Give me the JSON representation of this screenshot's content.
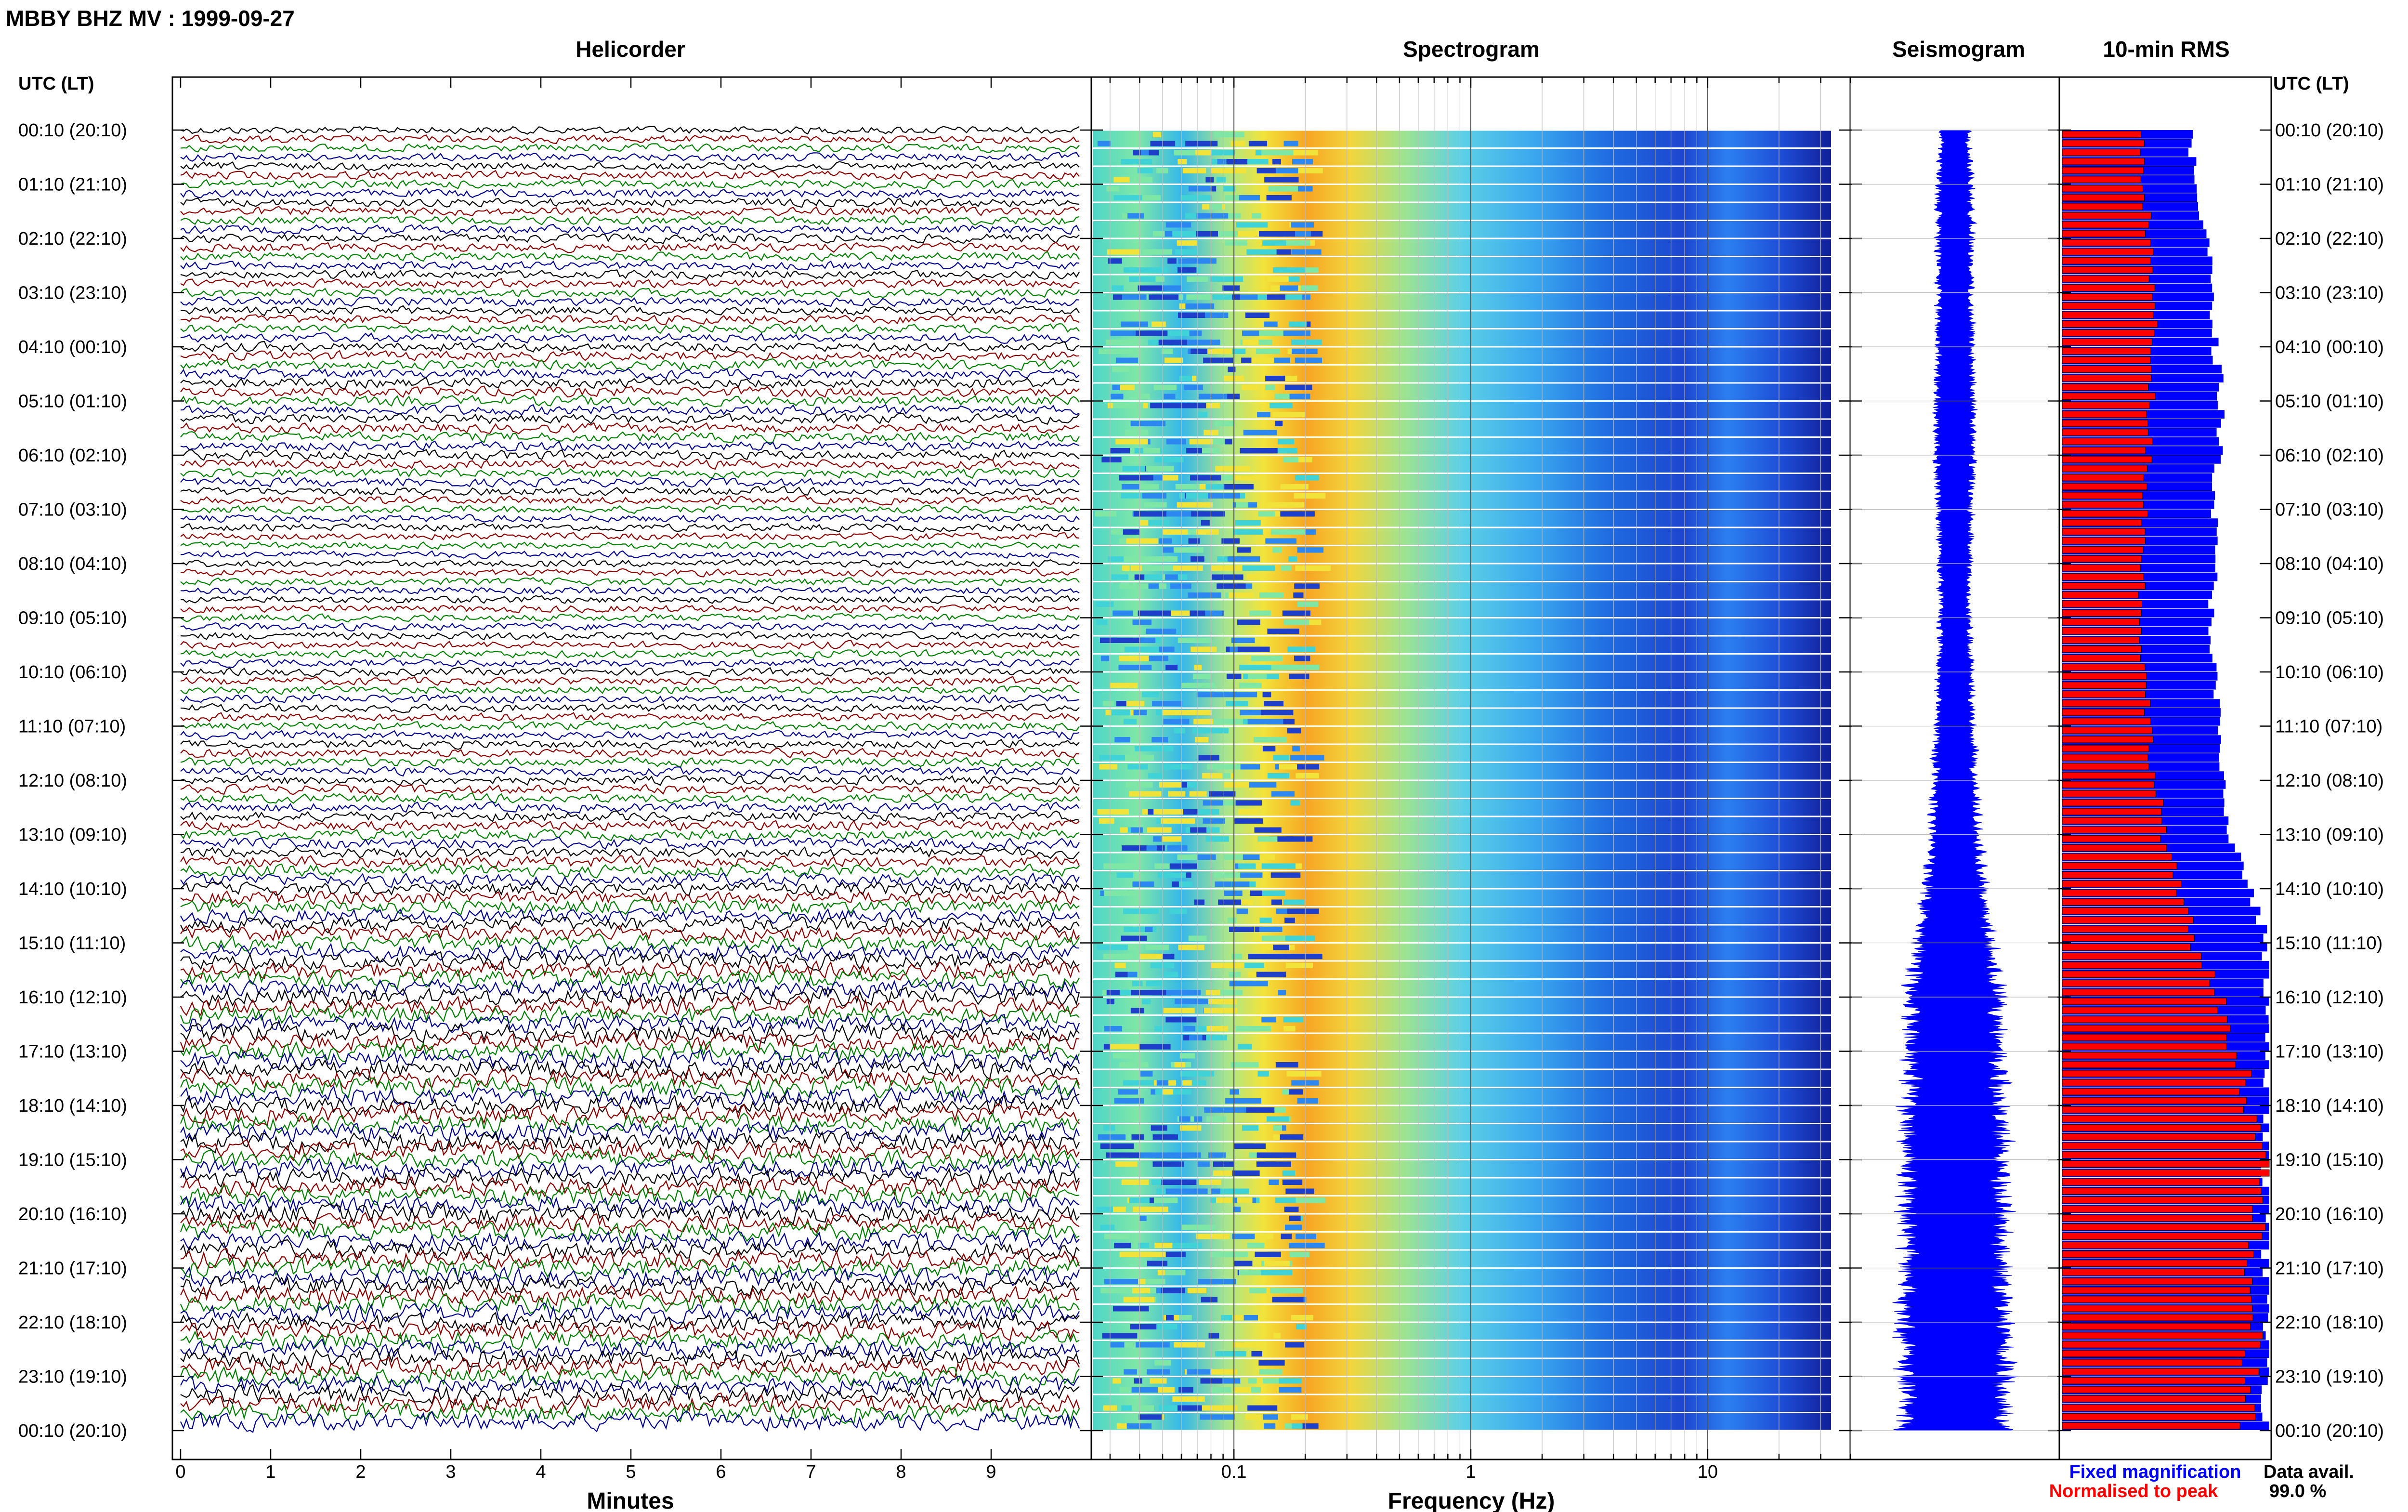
{
  "title": "MBBY BHZ MV : 1999-09-27",
  "time_axis_label": "UTC (LT)",
  "time_axis_label_right": "UTC (LT)",
  "panels": {
    "helicorder": "Helicorder",
    "spectrogram": "Spectrogram",
    "seismogram": "Seismogram",
    "rms": "10-min RMS"
  },
  "x_labels": {
    "helicorder": "Minutes",
    "spectrogram": "Frequency (Hz)"
  },
  "legend": {
    "fixed": "Fixed magnification",
    "fixed_color": "#0000ff",
    "normalised": "Normalised to peak",
    "normalised_color": "#ff0000"
  },
  "data_avail": {
    "label": "Data avail.",
    "value": "99.0 %"
  },
  "colors": {
    "trace_cycle": [
      "#000000",
      "#8b0000",
      "#008000",
      "#00008b"
    ],
    "seismogram": "#0000ff",
    "rms_fixed": "#0000ff",
    "rms_normalised": "#ff0000"
  },
  "chart_data": [
    {
      "type": "line",
      "title": "Helicorder",
      "xlabel": "Minutes",
      "ylabel": "UTC (LT)",
      "xlim": [
        0,
        10
      ],
      "x_ticks": [
        "0",
        "1",
        "2",
        "3",
        "4",
        "5",
        "6",
        "7",
        "8",
        "9"
      ],
      "y_ticks": [
        "00:10 (20:10)",
        "01:10 (21:10)",
        "02:10 (22:10)",
        "03:10 (23:10)",
        "04:10 (00:10)",
        "05:10 (01:10)",
        "06:10 (02:10)",
        "07:10 (03:10)",
        "08:10 (04:10)",
        "09:10 (05:10)",
        "10:10 (06:10)",
        "11:10 (07:10)",
        "12:10 (08:10)",
        "13:10 (09:10)",
        "14:10 (10:10)",
        "15:10 (11:10)",
        "16:10 (12:10)",
        "17:10 (13:10)",
        "18:10 (14:10)",
        "19:10 (15:10)",
        "20:10 (16:10)",
        "21:10 (17:10)",
        "22:10 (18:10)",
        "23:10 (19:10)",
        "00:10 (20:10)"
      ],
      "row_minutes": 10,
      "relative_amplitude_by_hour": [
        0.4,
        0.45,
        0.48,
        0.45,
        0.5,
        0.55,
        0.52,
        0.4,
        0.38,
        0.4,
        0.42,
        0.45,
        0.48,
        0.55,
        0.7,
        0.85,
        0.95,
        1.0,
        1.0,
        1.0,
        0.98,
        0.98,
        0.98,
        0.98
      ]
    },
    {
      "type": "heatmap",
      "title": "Spectrogram",
      "xlabel": "Frequency (Hz)",
      "x_scale": "log",
      "xlim": [
        0.025,
        40
      ],
      "x_ticks": [
        "0.1",
        "1",
        "10"
      ],
      "peak_frequency_hz": 0.33,
      "colormap": "jet"
    },
    {
      "type": "line",
      "title": "Seismogram",
      "relative_amplitude_by_hour": [
        0.2,
        0.22,
        0.24,
        0.22,
        0.24,
        0.25,
        0.25,
        0.22,
        0.2,
        0.2,
        0.22,
        0.24,
        0.28,
        0.32,
        0.38,
        0.5,
        0.6,
        0.62,
        0.64,
        0.66,
        0.66,
        0.66,
        0.68,
        0.7
      ]
    },
    {
      "type": "bar",
      "title": "10-min RMS",
      "series": [
        {
          "name": "Fixed magnification",
          "relative_by_hour": [
            0.62,
            0.65,
            0.72,
            0.72,
            0.75,
            0.78,
            0.76,
            0.74,
            0.74,
            0.73,
            0.74,
            0.76,
            0.78,
            0.82,
            0.92,
            1.0,
            1.0,
            1.0,
            1.0,
            1.0,
            1.0,
            1.0,
            1.0,
            1.0
          ]
        },
        {
          "name": "Normalised to peak",
          "relative_by_hour": [
            0.38,
            0.4,
            0.42,
            0.44,
            0.44,
            0.43,
            0.42,
            0.4,
            0.39,
            0.38,
            0.4,
            0.42,
            0.45,
            0.5,
            0.56,
            0.65,
            0.76,
            0.85,
            0.92,
            0.98,
            0.95,
            0.88,
            0.93,
            0.9
          ]
        }
      ]
    }
  ]
}
